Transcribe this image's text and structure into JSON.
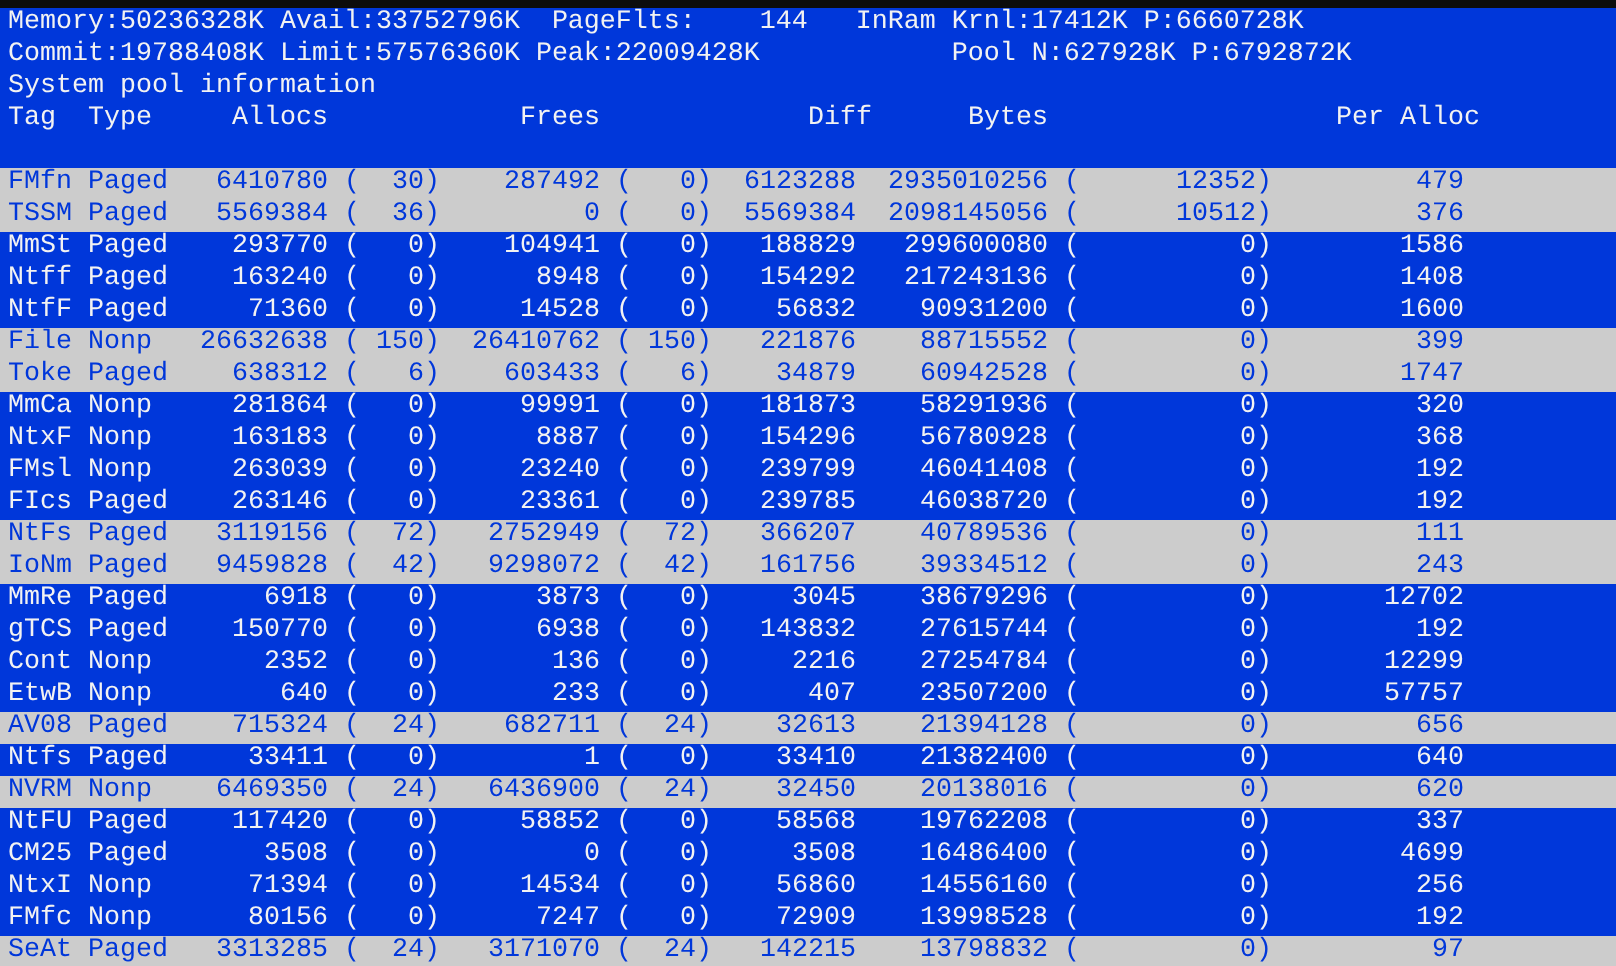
{
  "summary_lines": [
    "Memory:50236328K Avail:33752796K  PageFlts:    144   InRam Krnl:17412K P:6660728K",
    "Commit:19788408K Limit:57576360K Peak:22009428K            Pool N:627928K P:6792872K",
    "System pool information"
  ],
  "columns": {
    "tag": "Tag",
    "type": "Type",
    "allocs": "Allocs",
    "frees": "Frees",
    "diff": "Diff",
    "bytes": "Bytes",
    "per_alloc": "Per Alloc"
  },
  "rows": [
    {
      "tag": "FMfn",
      "type": "Paged",
      "allocs": "6410780",
      "allocs_change": "(  30)",
      "frees": "287492",
      "frees_change": "(   0)",
      "diff": "6123288",
      "bytes": "2935010256",
      "bytes_change": "(      12352)",
      "per_alloc": "479",
      "highlighted": true
    },
    {
      "tag": "TSSM",
      "type": "Paged",
      "allocs": "5569384",
      "allocs_change": "(  36)",
      "frees": "0",
      "frees_change": "(   0)",
      "diff": "5569384",
      "bytes": "2098145056",
      "bytes_change": "(      10512)",
      "per_alloc": "376",
      "highlighted": true
    },
    {
      "tag": "MmSt",
      "type": "Paged",
      "allocs": "293770",
      "allocs_change": "(   0)",
      "frees": "104941",
      "frees_change": "(   0)",
      "diff": "188829",
      "bytes": "299600080",
      "bytes_change": "(          0)",
      "per_alloc": "1586",
      "highlighted": false
    },
    {
      "tag": "Ntff",
      "type": "Paged",
      "allocs": "163240",
      "allocs_change": "(   0)",
      "frees": "8948",
      "frees_change": "(   0)",
      "diff": "154292",
      "bytes": "217243136",
      "bytes_change": "(          0)",
      "per_alloc": "1408",
      "highlighted": false
    },
    {
      "tag": "NtfF",
      "type": "Paged",
      "allocs": "71360",
      "allocs_change": "(   0)",
      "frees": "14528",
      "frees_change": "(   0)",
      "diff": "56832",
      "bytes": "90931200",
      "bytes_change": "(          0)",
      "per_alloc": "1600",
      "highlighted": false
    },
    {
      "tag": "File",
      "type": "Nonp",
      "allocs": "26632638",
      "allocs_change": "( 150)",
      "frees": "26410762",
      "frees_change": "( 150)",
      "diff": "221876",
      "bytes": "88715552",
      "bytes_change": "(          0)",
      "per_alloc": "399",
      "highlighted": true
    },
    {
      "tag": "Toke",
      "type": "Paged",
      "allocs": "638312",
      "allocs_change": "(   6)",
      "frees": "603433",
      "frees_change": "(   6)",
      "diff": "34879",
      "bytes": "60942528",
      "bytes_change": "(          0)",
      "per_alloc": "1747",
      "highlighted": true
    },
    {
      "tag": "MmCa",
      "type": "Nonp",
      "allocs": "281864",
      "allocs_change": "(   0)",
      "frees": "99991",
      "frees_change": "(   0)",
      "diff": "181873",
      "bytes": "58291936",
      "bytes_change": "(          0)",
      "per_alloc": "320",
      "highlighted": false
    },
    {
      "tag": "NtxF",
      "type": "Nonp",
      "allocs": "163183",
      "allocs_change": "(   0)",
      "frees": "8887",
      "frees_change": "(   0)",
      "diff": "154296",
      "bytes": "56780928",
      "bytes_change": "(          0)",
      "per_alloc": "368",
      "highlighted": false
    },
    {
      "tag": "FMsl",
      "type": "Nonp",
      "allocs": "263039",
      "allocs_change": "(   0)",
      "frees": "23240",
      "frees_change": "(   0)",
      "diff": "239799",
      "bytes": "46041408",
      "bytes_change": "(          0)",
      "per_alloc": "192",
      "highlighted": false
    },
    {
      "tag": "FIcs",
      "type": "Paged",
      "allocs": "263146",
      "allocs_change": "(   0)",
      "frees": "23361",
      "frees_change": "(   0)",
      "diff": "239785",
      "bytes": "46038720",
      "bytes_change": "(          0)",
      "per_alloc": "192",
      "highlighted": false
    },
    {
      "tag": "NtFs",
      "type": "Paged",
      "allocs": "3119156",
      "allocs_change": "(  72)",
      "frees": "2752949",
      "frees_change": "(  72)",
      "diff": "366207",
      "bytes": "40789536",
      "bytes_change": "(          0)",
      "per_alloc": "111",
      "highlighted": true
    },
    {
      "tag": "IoNm",
      "type": "Paged",
      "allocs": "9459828",
      "allocs_change": "(  42)",
      "frees": "9298072",
      "frees_change": "(  42)",
      "diff": "161756",
      "bytes": "39334512",
      "bytes_change": "(          0)",
      "per_alloc": "243",
      "highlighted": true
    },
    {
      "tag": "MmRe",
      "type": "Paged",
      "allocs": "6918",
      "allocs_change": "(   0)",
      "frees": "3873",
      "frees_change": "(   0)",
      "diff": "3045",
      "bytes": "38679296",
      "bytes_change": "(          0)",
      "per_alloc": "12702",
      "highlighted": false
    },
    {
      "tag": "gTCS",
      "type": "Paged",
      "allocs": "150770",
      "allocs_change": "(   0)",
      "frees": "6938",
      "frees_change": "(   0)",
      "diff": "143832",
      "bytes": "27615744",
      "bytes_change": "(          0)",
      "per_alloc": "192",
      "highlighted": false
    },
    {
      "tag": "Cont",
      "type": "Nonp",
      "allocs": "2352",
      "allocs_change": "(   0)",
      "frees": "136",
      "frees_change": "(   0)",
      "diff": "2216",
      "bytes": "27254784",
      "bytes_change": "(          0)",
      "per_alloc": "12299",
      "highlighted": false
    },
    {
      "tag": "EtwB",
      "type": "Nonp",
      "allocs": "640",
      "allocs_change": "(   0)",
      "frees": "233",
      "frees_change": "(   0)",
      "diff": "407",
      "bytes": "23507200",
      "bytes_change": "(          0)",
      "per_alloc": "57757",
      "highlighted": false
    },
    {
      "tag": "AV08",
      "type": "Paged",
      "allocs": "715324",
      "allocs_change": "(  24)",
      "frees": "682711",
      "frees_change": "(  24)",
      "diff": "32613",
      "bytes": "21394128",
      "bytes_change": "(          0)",
      "per_alloc": "656",
      "highlighted": true
    },
    {
      "tag": "Ntfs",
      "type": "Paged",
      "allocs": "33411",
      "allocs_change": "(   0)",
      "frees": "1",
      "frees_change": "(   0)",
      "diff": "33410",
      "bytes": "21382400",
      "bytes_change": "(          0)",
      "per_alloc": "640",
      "highlighted": false
    },
    {
      "tag": "NVRM",
      "type": "Nonp",
      "allocs": "6469350",
      "allocs_change": "(  24)",
      "frees": "6436900",
      "frees_change": "(  24)",
      "diff": "32450",
      "bytes": "20138016",
      "bytes_change": "(          0)",
      "per_alloc": "620",
      "highlighted": true
    },
    {
      "tag": "NtFU",
      "type": "Paged",
      "allocs": "117420",
      "allocs_change": "(   0)",
      "frees": "58852",
      "frees_change": "(   0)",
      "diff": "58568",
      "bytes": "19762208",
      "bytes_change": "(          0)",
      "per_alloc": "337",
      "highlighted": false
    },
    {
      "tag": "CM25",
      "type": "Paged",
      "allocs": "3508",
      "allocs_change": "(   0)",
      "frees": "0",
      "frees_change": "(   0)",
      "diff": "3508",
      "bytes": "16486400",
      "bytes_change": "(          0)",
      "per_alloc": "4699",
      "highlighted": false
    },
    {
      "tag": "NtxI",
      "type": "Nonp",
      "allocs": "71394",
      "allocs_change": "(   0)",
      "frees": "14534",
      "frees_change": "(   0)",
      "diff": "56860",
      "bytes": "14556160",
      "bytes_change": "(          0)",
      "per_alloc": "256",
      "highlighted": false
    },
    {
      "tag": "FMfc",
      "type": "Nonp",
      "allocs": "80156",
      "allocs_change": "(   0)",
      "frees": "7247",
      "frees_change": "(   0)",
      "diff": "72909",
      "bytes": "13998528",
      "bytes_change": "(          0)",
      "per_alloc": "192",
      "highlighted": false
    },
    {
      "tag": "SeAt",
      "type": "Paged",
      "allocs": "3313285",
      "allocs_change": "(  24)",
      "frees": "3171070",
      "frees_change": "(  24)",
      "diff": "142215",
      "bytes": "13798832",
      "bytes_change": "(          0)",
      "per_alloc": "97",
      "highlighted": true
    }
  ]
}
